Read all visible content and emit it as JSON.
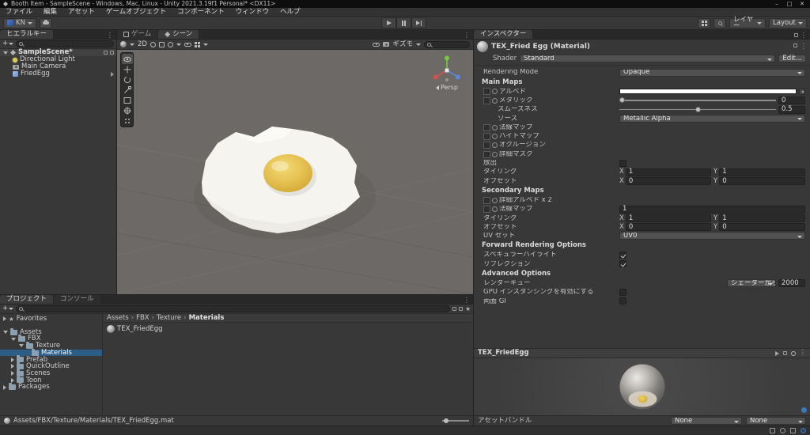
{
  "title_bar": {
    "title": "Booth Item - SampleScene - Windows, Mac, Linux - Unity 2021.3.19f1 Personal* <DX11>"
  },
  "icons": {
    "minimize": "–",
    "maximize": "□",
    "close": "✕",
    "menu": "⋮",
    "plus": "+",
    "star": "★",
    "crumb": "›"
  },
  "menu": [
    "ファイル",
    "編集",
    "アセット",
    "ゲームオブジェクト",
    "コンポーネント",
    "ウィンドウ",
    "ヘルプ"
  ],
  "toolbar": {
    "account": "KN",
    "layers": "レイヤー",
    "layout": "Layout"
  },
  "hierarchy": {
    "tab": "ヒエラルキー",
    "scene": "SampleScene*",
    "items": [
      "Directional Light",
      "Main Camera",
      "FriedEgg"
    ]
  },
  "scene": {
    "tab_game": "ゲーム",
    "tab_scene": "シーン",
    "mode_2d": "2D",
    "gizmos": "ギズモ",
    "persp": "Persp"
  },
  "inspector": {
    "tab": "インスペクター",
    "title": "TEX_Fried Egg (Material)",
    "shader_label": "Shader",
    "shader_value": "Standard",
    "edit_button": "Edit...",
    "rendering_mode": {
      "label": "Rendering Mode",
      "value": "Opaque"
    },
    "main_maps": "Main Maps",
    "albedo": "アルベド",
    "metallic": {
      "label": "メタリック",
      "value": "0"
    },
    "smoothness": {
      "label": "スムーズネス",
      "value": "0.5"
    },
    "source": {
      "label": "ソース",
      "value": "Metallic Alpha"
    },
    "normal_map": "法線マップ",
    "height_map": "ハイトマップ",
    "occlusion": "オクルージョン",
    "detail_mask": "詳細マスク",
    "emission": "放出",
    "tiling": {
      "label": "タイリング",
      "x": "1",
      "y": "1"
    },
    "offset": {
      "label": "オフセット",
      "x": "0",
      "y": "0"
    },
    "secondary_maps": "Secondary Maps",
    "detail_albedo": "詳細アルベド x 2",
    "normal_map2": {
      "label": "法線マップ",
      "value": "1"
    },
    "tiling2": {
      "label": "タイリング",
      "x": "1",
      "y": "1"
    },
    "offset2": {
      "label": "オフセット",
      "x": "0",
      "y": "0"
    },
    "uv_set": {
      "label": "UV セット",
      "value": "UV0"
    },
    "forward_options": "Forward Rendering Options",
    "specular_highlights": "スペキュラーハイライト",
    "reflections": "リフレクション",
    "advanced_options": "Advanced Options",
    "render_queue": {
      "label": "レンダーキュー",
      "mode": "シェーダーから",
      "value": "2000"
    },
    "gpu_instancing": "GPU インスタンシングを有効にする",
    "double_sided_gi": "両面 GI",
    "xy": {
      "x": "X",
      "y": "Y"
    },
    "preview": {
      "title": "TEX_FriedEgg",
      "assetbundle_label": "アセットバンドル",
      "bundle": "None",
      "variant": "None"
    }
  },
  "project": {
    "tab_project": "プロジェクト",
    "tab_console": "コンソール",
    "favorites": "Favorites",
    "assets": "Assets",
    "packages": "Packages",
    "tree": [
      "FBX",
      "Texture",
      "Materials",
      "Prefab",
      "QuickOutline",
      "Scenes",
      "Toon"
    ],
    "breadcrumb": [
      "Assets",
      "FBX",
      "Texture",
      "Materials"
    ],
    "file": "TEX_FriedEgg",
    "path": "Assets/FBX/Texture/Materials/TEX_FriedEgg.mat"
  },
  "colors": {
    "selection": "#2c5d87",
    "scene_background": "#6c6966",
    "yolk": "#d9b23c",
    "accent_blue": "#3a79bb"
  }
}
